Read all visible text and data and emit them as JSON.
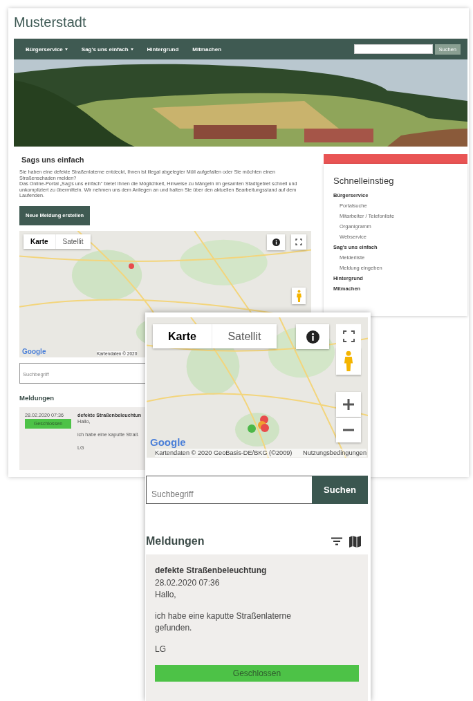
{
  "desktop": {
    "site_title": "Musterstadt",
    "nav": {
      "items": [
        {
          "label": "Bürgerservice",
          "dropdown": true
        },
        {
          "label": "Sag's uns einfach",
          "dropdown": true
        },
        {
          "label": "Hintergrund",
          "dropdown": false
        },
        {
          "label": "Mitmachen",
          "dropdown": false
        }
      ],
      "search_button": "Suchen"
    },
    "main": {
      "heading": "Sags uns einfach",
      "intro": [
        "Sie haben eine defekte Straßenlaterne entdeckt, Ihnen ist illegal abgelegter Müll aufgefallen oder Sie möchten einen Straßenschaden melden?",
        "Das Online-Portal „Sag's uns einfach\" bietet Ihnen die Möglichkeit, Hinweise zu Mängeln im gesamten Stadtgebiet schnell und unkompliziert zu übermitteln. Wir nehmen uns dem Anliegen an und halten Sie über den aktuellen Bearbeitungsstand auf dem Laufenden."
      ],
      "new_report_button": "Neue Meldung erstellen",
      "map": {
        "map_types": [
          {
            "label": "Karte",
            "selected": true
          },
          {
            "label": "Satellit",
            "selected": false
          }
        ],
        "google_logo": "Google",
        "attribution": "Kartendaten © 2020",
        "markers": [
          {
            "color": "#e84c4c"
          }
        ]
      },
      "search": {
        "placeholder": "Suchbegriff"
      },
      "reports_heading": "Meldungen",
      "reports": [
        {
          "date": "28.02.2020 07:36",
          "status": "Geschlossen",
          "color": "#4dc247",
          "title": "defekte Straßenbeleuchtun",
          "lines": [
            "Hallo,",
            "ich habe eine kaputte Straß",
            "LG"
          ]
        }
      ]
    },
    "sidebar": {
      "title": "Schnelleinstieg",
      "sections": [
        {
          "label": "Bürgerservice",
          "children": [
            {
              "label": "Portalsuche"
            },
            {
              "label": "Mitarbeiter / Telefonliste"
            },
            {
              "label": "Organigramm"
            },
            {
              "label": "Webservice"
            }
          ]
        },
        {
          "label": "Sag's uns einfach",
          "children": [
            {
              "label": "Melderliste"
            },
            {
              "label": "Meldung eingeben"
            }
          ]
        },
        {
          "label": "Hintergrund"
        },
        {
          "label": "Mitmachen"
        }
      ]
    }
  },
  "mobile": {
    "map": {
      "map_types": [
        {
          "label": "Karte",
          "selected": true
        },
        {
          "label": "Satellit",
          "selected": false
        }
      ],
      "google_logo": "Google",
      "attribution": "Kartendaten © 2020 GeoBasis-DE/BKG (©2009)",
      "terms_link": "Nutzungsbedingungen",
      "markers": [
        {
          "color": "#e84c4c"
        },
        {
          "color": "#f0a030"
        },
        {
          "color": "#4cb848"
        },
        {
          "color": "#e84c4c"
        }
      ]
    },
    "search": {
      "placeholder": "Suchbegriff",
      "button": "Suchen"
    },
    "reports_heading": "Meldungen",
    "reports": [
      {
        "title": "defekte Straßenbeleuchtung",
        "date": "28.02.2020 07:36",
        "lines": [
          "Hallo,",
          "ich habe eine kaputte Straßenlaterne gefunden.",
          "LG"
        ],
        "status": "Geschlossen",
        "color": "#4dc247"
      }
    ]
  }
}
